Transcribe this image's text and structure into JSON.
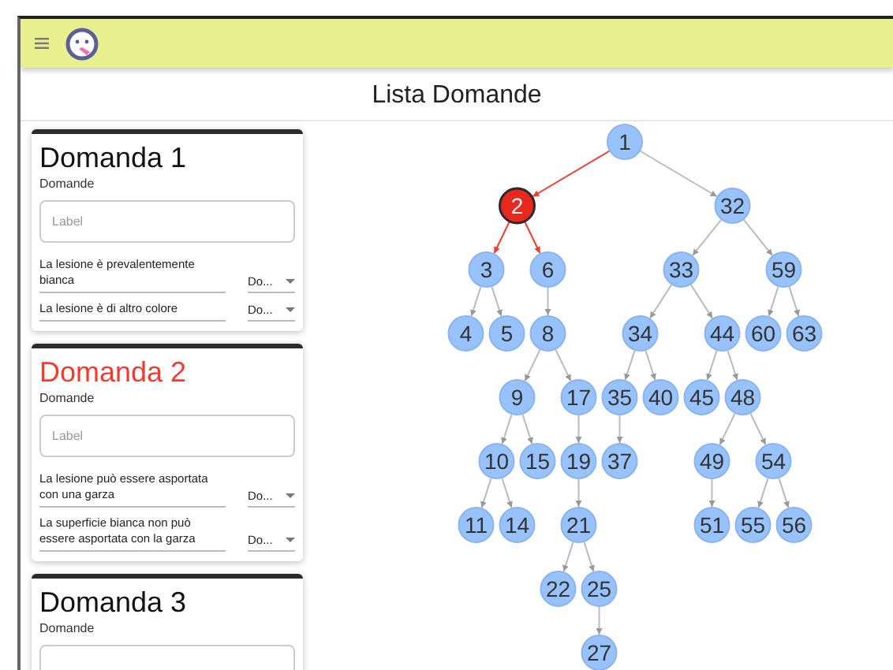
{
  "title": "Lista Domande",
  "questions": [
    {
      "title": "Domanda 1",
      "selected": false,
      "subtitle": "Domande",
      "placeholder": "Label",
      "answers": [
        {
          "text": "La lesione è prevalentemente bianca",
          "value": "Do..."
        },
        {
          "text": "La lesione è di altro colore",
          "value": "Do..."
        }
      ]
    },
    {
      "title": "Domanda 2",
      "selected": true,
      "subtitle": "Domande",
      "placeholder": "Label",
      "answers": [
        {
          "text": "La lesione può essere asportata con una garza",
          "value": "Do..."
        },
        {
          "text": "La superficie bianca non può essere asportata con la garza",
          "value": "Do..."
        }
      ]
    },
    {
      "title": "Domanda 3",
      "selected": false,
      "subtitle": "Domande"
    }
  ],
  "tree": {
    "label": "1",
    "selected": false,
    "children": [
      {
        "label": "2",
        "selected": true,
        "children": [
          {
            "label": "3",
            "selected": false,
            "children": [
              {
                "label": "4",
                "selected": false
              },
              {
                "label": "5",
                "selected": false
              }
            ]
          },
          {
            "label": "6",
            "selected": false,
            "children": [
              {
                "label": "8",
                "selected": false,
                "children": [
                  {
                    "label": "9",
                    "selected": false,
                    "children": [
                      {
                        "label": "10",
                        "selected": false,
                        "children": [
                          {
                            "label": "11",
                            "selected": false
                          },
                          {
                            "label": "14",
                            "selected": false
                          }
                        ]
                      },
                      {
                        "label": "15",
                        "selected": false
                      }
                    ]
                  },
                  {
                    "label": "17",
                    "selected": false,
                    "children": [
                      {
                        "label": "19",
                        "selected": false,
                        "children": [
                          {
                            "label": "21",
                            "selected": false,
                            "children": [
                              {
                                "label": "22",
                                "selected": false
                              },
                              {
                                "label": "25",
                                "selected": false,
                                "children": [
                                  {
                                    "label": "27",
                                    "selected": false
                                  }
                                ]
                              }
                            ]
                          }
                        ]
                      }
                    ]
                  }
                ]
              }
            ]
          }
        ]
      },
      {
        "label": "32",
        "selected": false,
        "children": [
          {
            "label": "33",
            "selected": false,
            "children": [
              {
                "label": "34",
                "selected": false,
                "children": [
                  {
                    "label": "35",
                    "selected": false,
                    "children": [
                      {
                        "label": "37",
                        "selected": false
                      }
                    ]
                  },
                  {
                    "label": "40",
                    "selected": false
                  }
                ]
              },
              {
                "label": "44",
                "selected": false,
                "children": [
                  {
                    "label": "45",
                    "selected": false
                  },
                  {
                    "label": "48",
                    "selected": false,
                    "children": [
                      {
                        "label": "49",
                        "selected": false,
                        "children": [
                          {
                            "label": "51",
                            "selected": false
                          }
                        ]
                      },
                      {
                        "label": "54",
                        "selected": false,
                        "children": [
                          {
                            "label": "55",
                            "selected": false
                          },
                          {
                            "label": "56",
                            "selected": false
                          }
                        ]
                      }
                    ]
                  }
                ]
              }
            ]
          },
          {
            "label": "59",
            "selected": false,
            "children": [
              {
                "label": "60",
                "selected": false
              },
              {
                "label": "63",
                "selected": false
              }
            ]
          }
        ]
      }
    ]
  }
}
